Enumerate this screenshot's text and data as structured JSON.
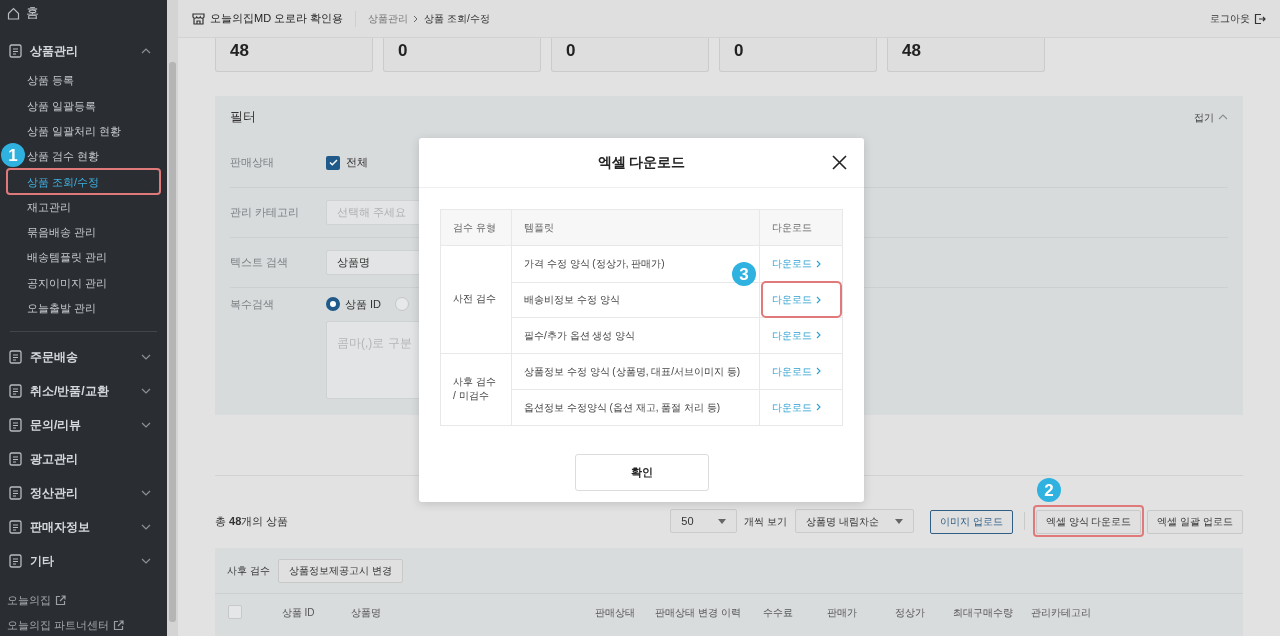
{
  "header": {
    "store_name": "오늘의집MD 오로라 확인용",
    "breadcrumb": [
      "상품관리",
      "상품 조회/수정"
    ],
    "logout": "로그아웃"
  },
  "sidebar": {
    "items": [
      {
        "kind": "home",
        "label": "홈"
      },
      {
        "kind": "group",
        "label": "상품관리",
        "expanded": true,
        "children": [
          {
            "label": "상품 등록",
            "selected": false
          },
          {
            "label": "상품 일괄등록",
            "selected": false
          },
          {
            "label": "상품 일괄처리 현황",
            "selected": false
          },
          {
            "label": "상품 검수 현황",
            "selected": false
          },
          {
            "label": "상품 조회/수정",
            "selected": true,
            "callout": "1"
          },
          {
            "label": "재고관리",
            "selected": false
          },
          {
            "label": "묶음배송 관리",
            "selected": false
          },
          {
            "label": "배송템플릿 관리",
            "selected": false
          },
          {
            "label": "공지이미지 관리",
            "selected": false
          },
          {
            "label": "오늘출발 관리",
            "selected": false
          }
        ]
      },
      {
        "kind": "group",
        "label": "주문배송",
        "expanded": false
      },
      {
        "kind": "group",
        "label": "취소/반품/교환",
        "expanded": false
      },
      {
        "kind": "group",
        "label": "문의/리뷰",
        "expanded": false
      },
      {
        "kind": "single",
        "label": "광고관리"
      },
      {
        "kind": "group",
        "label": "정산관리",
        "expanded": false
      },
      {
        "kind": "group",
        "label": "판매자정보",
        "expanded": false
      },
      {
        "kind": "group",
        "label": "기타",
        "expanded": false
      }
    ],
    "links": [
      "오늘의집",
      "오늘의집 파트너센터"
    ]
  },
  "stats": [
    "48",
    "0",
    "0",
    "0",
    "48"
  ],
  "filter": {
    "title": "필터",
    "collapse": "접기",
    "rows": [
      {
        "kind": "checkbox",
        "label": "판매상태",
        "option": "전체",
        "checked": true
      },
      {
        "kind": "select",
        "label": "관리 카테고리",
        "placeholder": "선택해 주세요"
      },
      {
        "kind": "select",
        "label": "텍스트 검색",
        "value": "상품명"
      },
      {
        "kind": "radio",
        "label": "복수검색",
        "options": [
          {
            "label": "상품 ID",
            "selected": true
          },
          {
            "selected": false
          }
        ],
        "placeholder": "콤마(,)로 구분"
      }
    ]
  },
  "list": {
    "total": "총 **48**개의 상품",
    "page_size": "50",
    "page_size_label": "개씩 보기",
    "sort": "상품명 내림차순",
    "buttons": [
      {
        "label": "이미지 업로드",
        "kind": "outline"
      },
      {
        "label": "엑셀 양식 다운로드",
        "kind": "plain",
        "callout": "2"
      },
      {
        "label": "엑셀 일괄 업로드",
        "kind": "plain"
      }
    ]
  },
  "table": {
    "select_all_checked": false,
    "toolbar_label": "사후 검수",
    "toolbar_button": "상품정보제공고시 변경",
    "columns": [
      "상품 ID",
      "상품명",
      "판매상태",
      "판매상태 변경 이력",
      "수수료",
      "판매가",
      "정상가",
      "최대구매수량",
      "관리카테고리"
    ]
  },
  "modal": {
    "title": "엑셀 다운로드",
    "columns": [
      "검수 유형",
      "템플릿",
      "다운로드"
    ],
    "groups": [
      {
        "type": "사전 검수",
        "rows": [
          {
            "template": "가격 수정 양식 (정상가, 판매가)",
            "link": "다운로드"
          },
          {
            "template": "배송비정보 수정 양식",
            "link": "다운로드",
            "callout": "3"
          },
          {
            "template": "필수/추가 옵션 생성 양식",
            "link": "다운로드"
          }
        ]
      },
      {
        "type": "사후 검수\n/ 미검수",
        "rows": [
          {
            "template": "상품정보 수정 양식 (상품명, 대표/서브이미지 등)",
            "link": "다운로드"
          },
          {
            "template": "옵션정보 수정양식 (옵션 재고, 품절 처리 등)",
            "link": "다운로드"
          }
        ]
      }
    ],
    "confirm": "확인"
  }
}
